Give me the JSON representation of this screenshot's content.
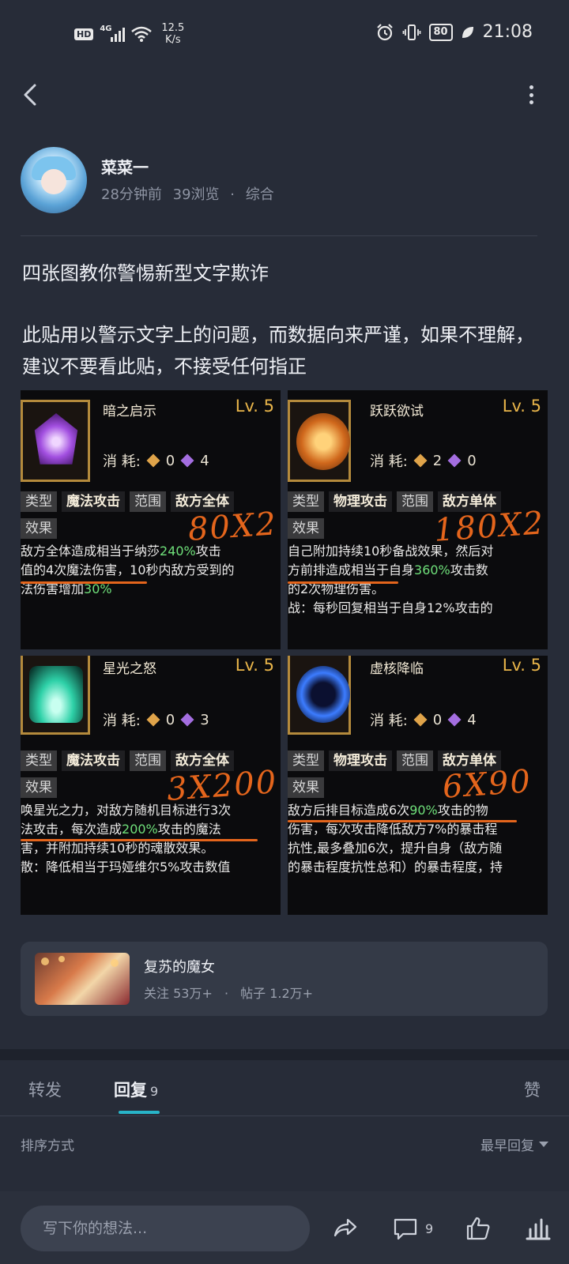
{
  "status_bar": {
    "hd": "HD",
    "network": "4G",
    "speed_value": "12.5",
    "speed_unit": "K/s",
    "battery": "80",
    "time": "21:08"
  },
  "author": {
    "name": "菜菜一",
    "time_ago": "28分钟前",
    "views": "39浏览",
    "separator": "·",
    "category": "综合"
  },
  "post": {
    "title": "四张图教你警惕新型文字欺诈",
    "body": "此贴用以警示文字上的问题，而数据向来严谨，如果不理解，建议不要看此贴，不接受任何指正"
  },
  "cards": [
    {
      "skill": "暗之启示",
      "level": "Lv. 5",
      "cost_label": "消 耗:",
      "cost_gold": "0",
      "cost_purple": "4",
      "type_label": "类型",
      "type_value": "魔法攻击",
      "range_label": "范围",
      "range_value": "敌方全体",
      "effect_label": "效果",
      "annotation": "80X2",
      "line1_a": "敌方全体造成相当于纳莎",
      "line1_hl": "240%",
      "line1_b": "攻击",
      "line2": "值的4次魔法伤害，10秒内敌方受到的",
      "line3_a": "法伤害增加",
      "line3_hl": "30%"
    },
    {
      "skill": "跃跃欲试",
      "level": "Lv. 5",
      "cost_label": "消 耗:",
      "cost_gold": "2",
      "cost_purple": "0",
      "type_label": "类型",
      "type_value": "物理攻击",
      "range_label": "范围",
      "range_value": "敌方单体",
      "effect_label": "效果",
      "annotation": "180X2",
      "line1": "自己附加持续10秒备战效果，然后对",
      "line2_a": "方前排造成相当于自身",
      "line2_hl": "360%",
      "line2_b": "攻击数",
      "line3": "的2次物理伤害。",
      "line4": "战：每秒回复相当于自身12%攻击的"
    },
    {
      "skill": "星光之怒",
      "level": "Lv. 5",
      "cost_label": "消 耗:",
      "cost_gold": "0",
      "cost_purple": "3",
      "type_label": "类型",
      "type_value": "魔法攻击",
      "range_label": "范围",
      "range_value": "敌方全体",
      "effect_label": "效果",
      "annotation": "3X200",
      "line1": "唤星光之力，对敌方随机目标进行3次",
      "line2_a": "法攻击，每次造成",
      "line2_hl": "200%",
      "line2_b": "攻击的魔法",
      "line3": "害，并附加持续10秒的魂散效果。",
      "line4": "散：降低相当于玛娅维尔5%攻击数值"
    },
    {
      "skill": "虚核降临",
      "level": "Lv. 5",
      "cost_label": "消 耗:",
      "cost_gold": "0",
      "cost_purple": "4",
      "type_label": "类型",
      "type_value": "物理攻击",
      "range_label": "范围",
      "range_value": "敌方单体",
      "effect_label": "效果",
      "annotation": "6X90",
      "line1_a": "敌方后排目标造成6次",
      "line1_hl": "90%",
      "line1_b": "攻击的物",
      "line2": "伤害，每次攻击降低敌方7%的暴击程",
      "line3": "抗性,最多叠加6次，提升自身（敌方随",
      "line4": "的暴击程度抗性总和）的暴击程度，持"
    }
  ],
  "community": {
    "name": "复苏的魔女",
    "followers": "关注 53万+",
    "separator": "·",
    "posts": "帖子 1.2万+"
  },
  "tabs": {
    "forward": "转发",
    "reply": "回复",
    "reply_count": "9",
    "like": "赞"
  },
  "sort": {
    "label": "排序方式",
    "order": "最早回复"
  },
  "bottom_bar": {
    "placeholder": "写下你的想法...",
    "comment_count": "9"
  }
}
